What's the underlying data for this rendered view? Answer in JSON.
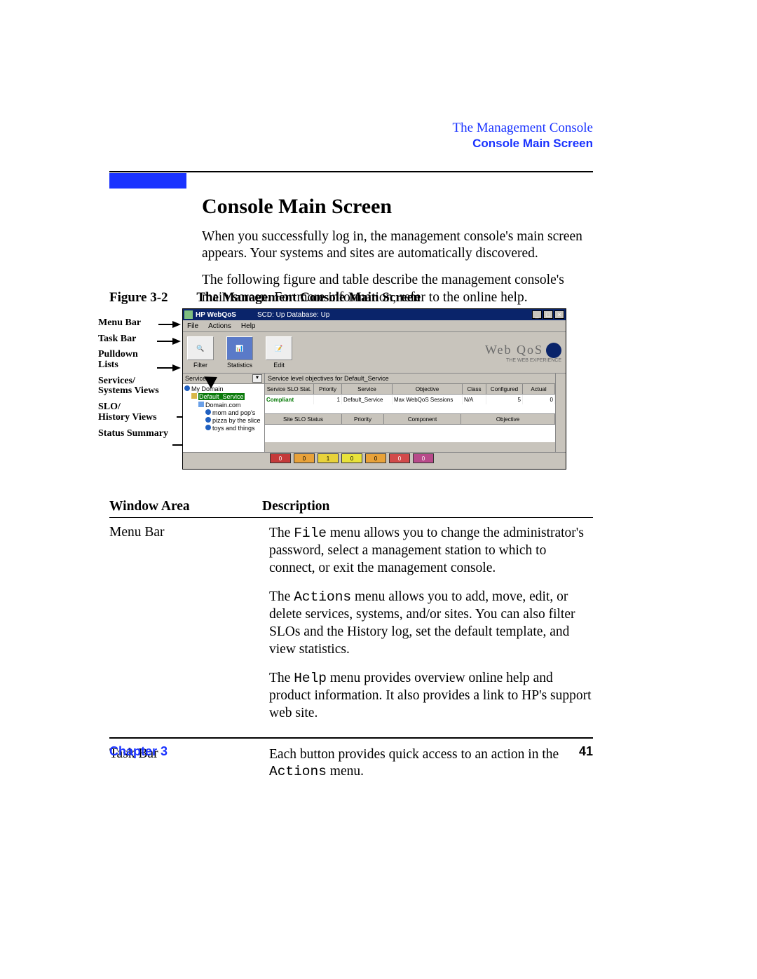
{
  "running_head": {
    "chapter_name": "The Management Console",
    "section_name": "Console Main Screen"
  },
  "heading": "Console Main Screen",
  "para1": "When you successfully log in, the management console's main screen appears. Your systems and sites are automatically discovered.",
  "para2": "The following figure and table describe the management console's main screen. For more information, refer to the online help.",
  "figure": {
    "label": "Figure 3-2",
    "caption": "The Management Console Main Screen"
  },
  "callouts": {
    "menu_bar": "Menu Bar",
    "task_bar": "Task Bar",
    "pulldown_lists": "Pulldown\nLists",
    "services_systems_views": "Services/\nSystems Views",
    "slo_history_views": "SLO/\nHistory Views",
    "status_summary": "Status Summary"
  },
  "window": {
    "title": "HP WebQoS",
    "status_line": "SCD: Up   Database: Up",
    "menus": {
      "file": "File",
      "actions": "Actions",
      "help": "Help"
    },
    "toolbar": {
      "filter": "Filter",
      "statistics": "Statistics",
      "edit": "Edit"
    },
    "logo_text": "Web QoS",
    "logo_tagline": "THE WEB EXPERIENCE",
    "tree": {
      "header": "Services",
      "root": "My Domain",
      "selected": "Default_Service",
      "domain": "Domain.com",
      "site1": "mom and pop's",
      "site2": "pizza by the slice",
      "site3": "toys and things"
    },
    "top_grid": {
      "caption": "Service level objectives for Default_Service",
      "headers": {
        "slo": "Service SLO Stat.",
        "priority": "Priority",
        "service": "Service",
        "objective": "Objective",
        "class": "Class",
        "configured": "Configured",
        "actual": "Actual"
      },
      "row1": {
        "slo": "Compliant",
        "priority": "1",
        "service": "Default_Service",
        "objective": "Max WebQoS Sessions",
        "class": "N/A",
        "configured": "5",
        "actual": "0"
      }
    },
    "bottom_grid": {
      "headers": {
        "status": "Site SLO Status",
        "priority": "Priority",
        "component": "Component",
        "objective": "Objective"
      }
    },
    "status_values": [
      "0",
      "0",
      "1",
      "0",
      "0",
      "0",
      "0"
    ]
  },
  "table": {
    "head_wa": "Window Area",
    "head_desc": "Description",
    "rows": [
      {
        "wa": "Menu Bar",
        "paras": [
          {
            "pre": "The ",
            "code": "File",
            "post": " menu allows you to change the administrator's password, select a management station to which to connect, or exit the management console."
          },
          {
            "pre": "The ",
            "code": "Actions",
            "post": " menu allows you to add, move, edit, or delete services, systems, and/or sites. You can also filter SLOs and the History log, set the default template, and view statistics."
          },
          {
            "pre": "The ",
            "code": "Help",
            "post": " menu provides overview online help and product information. It also provides a link to HP's support web site."
          }
        ]
      },
      {
        "wa": "Task Bar",
        "paras": [
          {
            "pre": "Each button provides quick access to an action in the ",
            "code": "Actions",
            "post": " menu."
          }
        ]
      }
    ]
  },
  "footer": {
    "chapter": "Chapter 3",
    "page": "41"
  }
}
